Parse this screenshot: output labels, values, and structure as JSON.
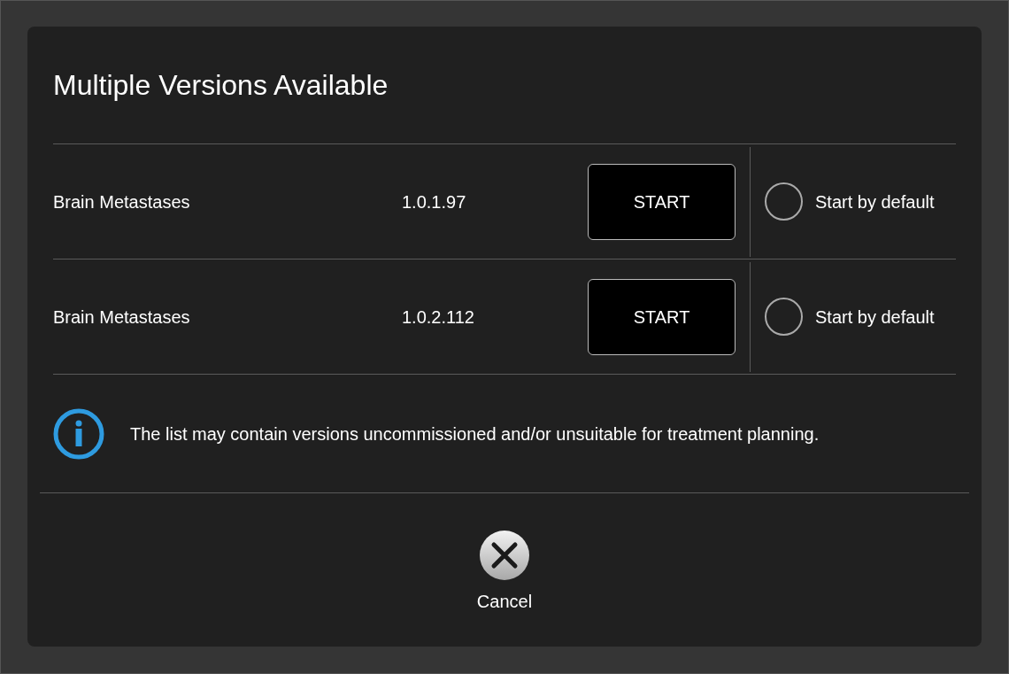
{
  "dialog": {
    "title": "Multiple Versions Available",
    "versions": [
      {
        "name": "Brain Metastases",
        "version": "1.0.1.97",
        "button": "START",
        "default_label": "Start by default",
        "selected": false
      },
      {
        "name": "Brain Metastases",
        "version": "1.0.2.112",
        "button": "START",
        "default_label": "Start by default",
        "selected": false
      }
    ],
    "info": "The list may contain versions uncommissioned and/or unsuitable for treatment planning.",
    "cancel": "Cancel"
  }
}
